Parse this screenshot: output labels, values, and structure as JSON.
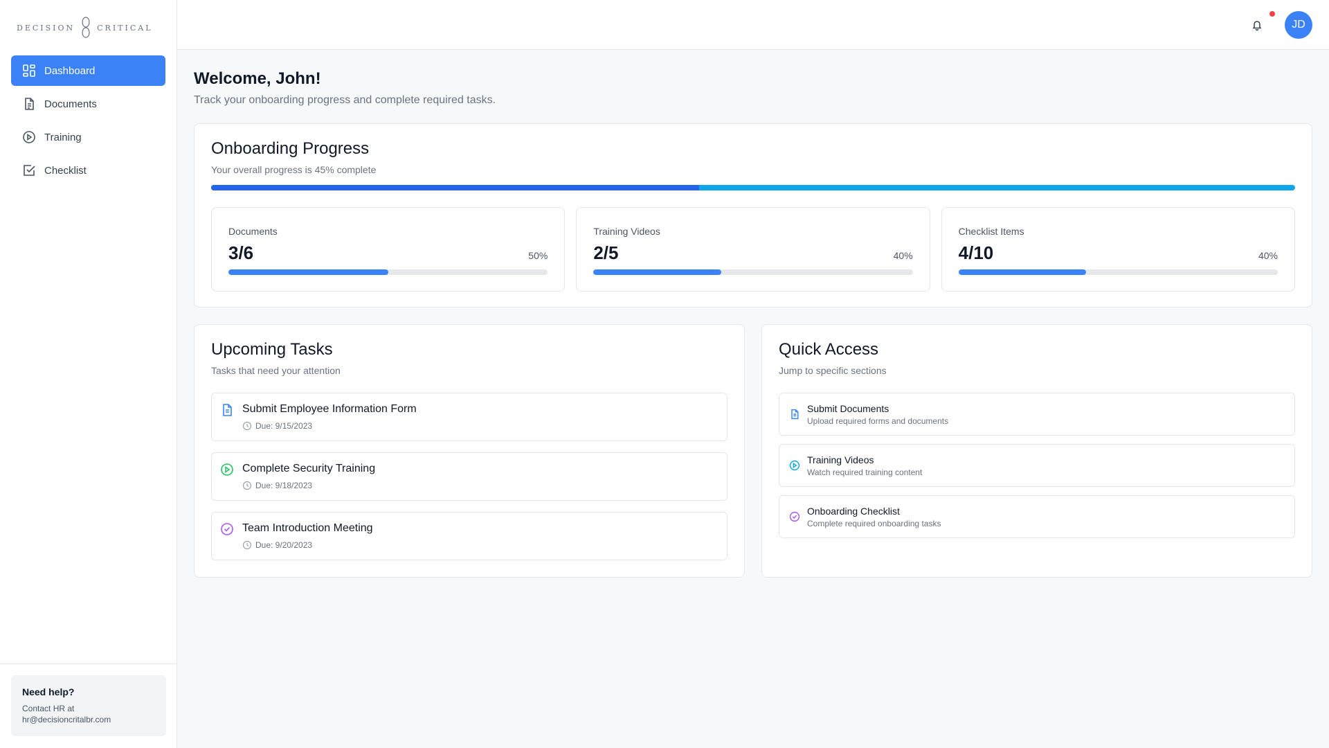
{
  "brand": {
    "left": "DECISION",
    "right": "CRITICAL"
  },
  "sidebar": {
    "items": [
      {
        "label": "Dashboard",
        "icon": "dashboard-icon"
      },
      {
        "label": "Documents",
        "icon": "document-icon"
      },
      {
        "label": "Training",
        "icon": "play-circle-icon"
      },
      {
        "label": "Checklist",
        "icon": "checkbox-icon"
      }
    ],
    "help": {
      "title": "Need help?",
      "text": "Contact HR at hr@decisioncritalbr.com"
    }
  },
  "topbar": {
    "avatar_initials": "JD"
  },
  "welcome": {
    "title": "Welcome, John!",
    "subtitle": "Track your onboarding progress and complete required tasks."
  },
  "progress": {
    "title": "Onboarding Progress",
    "subtitle": "Your overall progress is 45% complete",
    "overall_percent": 45,
    "stats": [
      {
        "label": "Documents",
        "value": "3/6",
        "percent_label": "50%",
        "percent": 50
      },
      {
        "label": "Training Videos",
        "value": "2/5",
        "percent_label": "40%",
        "percent": 40
      },
      {
        "label": "Checklist Items",
        "value": "4/10",
        "percent_label": "40%",
        "percent": 40
      }
    ]
  },
  "tasks": {
    "title": "Upcoming Tasks",
    "subtitle": "Tasks that need your attention",
    "items": [
      {
        "title": "Submit Employee Information Form",
        "due": "Due: 9/15/2023",
        "icon": "document-icon",
        "color": "#3b82f6"
      },
      {
        "title": "Complete Security Training",
        "due": "Due: 9/18/2023",
        "icon": "play-circle-icon",
        "color": "#22c55e"
      },
      {
        "title": "Team Introduction Meeting",
        "due": "Due: 9/20/2023",
        "icon": "check-circle-icon",
        "color": "#a855f7"
      }
    ]
  },
  "quick_access": {
    "title": "Quick Access",
    "subtitle": "Jump to specific sections",
    "items": [
      {
        "title": "Submit Documents",
        "desc": "Upload required forms and documents",
        "icon": "document-icon",
        "color": "#3b82f6"
      },
      {
        "title": "Training Videos",
        "desc": "Watch required training content",
        "icon": "play-circle-icon",
        "color": "#0ea5e9"
      },
      {
        "title": "Onboarding Checklist",
        "desc": "Complete required onboarding tasks",
        "icon": "check-circle-icon",
        "color": "#a855f7"
      }
    ]
  },
  "colors": {
    "accent": "#3b82f6",
    "progress_dark": "#2563eb",
    "progress_light": "#0ea5e9",
    "notification": "#ef4444"
  }
}
